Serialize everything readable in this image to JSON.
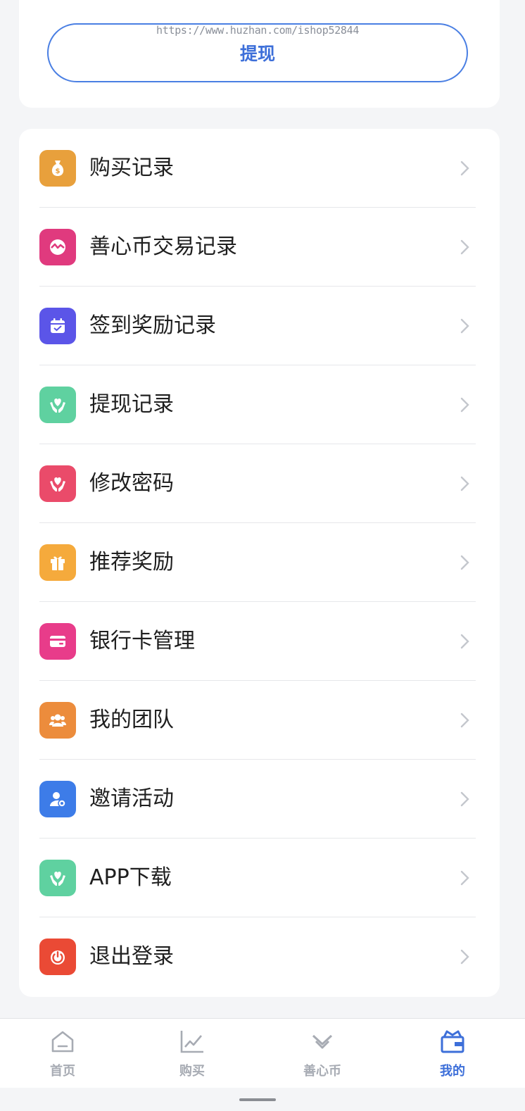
{
  "watermark": "https://www.huzhan.com/ishop52844",
  "withdraw_button": "提现",
  "menu": [
    {
      "label": "购买记录",
      "icon": "money-bag-icon",
      "color": "#e8a03c"
    },
    {
      "label": "善心币交易记录",
      "icon": "coin-exchange-icon",
      "color": "#e03a7e"
    },
    {
      "label": "签到奖励记录",
      "icon": "calendar-check-icon",
      "color": "#5b55e8"
    },
    {
      "label": "提现记录",
      "icon": "heart-hands-icon",
      "color": "#5fd1a0"
    },
    {
      "label": "修改密码",
      "icon": "heart-hands-icon",
      "color": "#ea4b6a"
    },
    {
      "label": "推荐奖励",
      "icon": "gift-icon",
      "color": "#f5aa3c"
    },
    {
      "label": "银行卡管理",
      "icon": "card-icon",
      "color": "#e83c8a"
    },
    {
      "label": "我的团队",
      "icon": "team-icon",
      "color": "#ec8c3c"
    },
    {
      "label": "邀请活动",
      "icon": "user-add-icon",
      "color": "#3d7ce8"
    },
    {
      "label": "APP下载",
      "icon": "heart-hands-icon",
      "color": "#5fd1a0"
    },
    {
      "label": "退出登录",
      "icon": "power-icon",
      "color": "#ea4a35"
    }
  ],
  "tabs": [
    {
      "label": "首页",
      "icon": "home-icon"
    },
    {
      "label": "购买",
      "icon": "chart-icon"
    },
    {
      "label": "善心币",
      "icon": "chevrons-down-icon"
    },
    {
      "label": "我的",
      "icon": "bag-icon",
      "active": true
    }
  ],
  "colors": {
    "accent": "#3d6fd9",
    "inactive_tab": "#a7abb3"
  }
}
